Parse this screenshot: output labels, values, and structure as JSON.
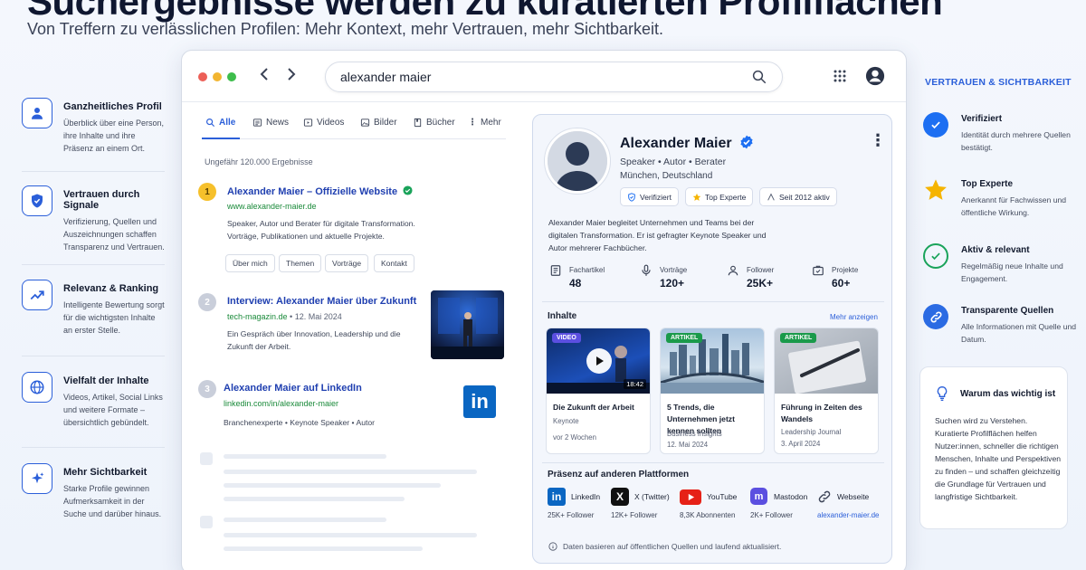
{
  "headline": "Suchergebnisse werden zu kuratierten Profilflächen",
  "subheadline": "Von Treffern zu verlässlichen Profilen: Mehr Kontext, mehr Vertrauen, mehr Sichtbarkeit.",
  "features": [
    {
      "icon": "user-icon",
      "title": "Ganzheitliches Profil",
      "desc": "Überblick über eine Person, ihre Inhalte und ihre Präsenz an einem Ort."
    },
    {
      "icon": "shield-icon",
      "title": "Vertrauen durch Signale",
      "desc": "Verifizierung, Quellen und Auszeichnungen schaffen Transparenz und Vertrauen."
    },
    {
      "icon": "trend-icon",
      "title": "Relevanz & Ranking",
      "desc": "Intelligente Bewertung sorgt für die wichtigsten Inhalte an erster Stelle."
    },
    {
      "icon": "globe-icon",
      "title": "Vielfalt der Inhalte",
      "desc": "Videos, Artikel, Social Links und weitere Formate – übersichtlich gebündelt."
    },
    {
      "icon": "sparkle-icon",
      "title": "Mehr Sichtbarkeit",
      "desc": "Starke Profile gewinnen Aufmerksamkeit in der Suche und darüber hinaus."
    }
  ],
  "search": {
    "query": "alexander maier"
  },
  "tabs": [
    "Alle",
    "News",
    "Videos",
    "Bilder",
    "Bücher",
    "Mehr"
  ],
  "result_count": "Ungefähr 120.000 Ergebnisse",
  "results": [
    {
      "num": "1",
      "title": "Alexander Maier – Offizielle Website",
      "url": "www.alexander-maier.de",
      "desc": "Speaker, Autor und Berater für digitale Transformation. Vorträge, Publikationen und aktuelle Projekte.",
      "chips": [
        "Über mich",
        "Themen",
        "Vorträge",
        "Kontakt"
      ]
    },
    {
      "num": "2",
      "title": "Interview: Alexander Maier über Zukunft",
      "url": "tech-magazin.de",
      "date": "12. Mai 2024",
      "desc": "Ein Gespräch über Innovation, Leadership und die Zukunft der Arbeit."
    },
    {
      "num": "3",
      "title": "Alexander Maier auf LinkedIn",
      "url": "linkedin.com/in/alexander-maier",
      "desc": "Branchenexperte • Keynote Speaker • Autor",
      "logo": "in"
    }
  ],
  "profile": {
    "name": "Alexander Maier",
    "role": "Speaker • Autor • Berater",
    "location": "München, Deutschland",
    "badges": [
      "Verifiziert",
      "Top Experte",
      "Seit 2012 aktiv"
    ],
    "bio": "Alexander Maier begleitet Unternehmen und Teams bei der digitalen Transformation. Er ist gefragter Keynote Speaker und Autor mehrerer Fachbücher.",
    "stats": [
      {
        "label": "Fachartikel",
        "value": "48"
      },
      {
        "label": "Vorträge",
        "value": "120+"
      },
      {
        "label": "Follower",
        "value": "25K+"
      },
      {
        "label": "Projekte",
        "value": "60+"
      }
    ],
    "content_title": "Inhalte",
    "more_label": "Mehr anzeigen",
    "cards": [
      {
        "tag": "VIDEO",
        "duration": "18:42",
        "title": "Die Zukunft der Arbeit",
        "source": "Keynote",
        "date": "vor 2 Wochen"
      },
      {
        "tag": "ARTIKEL",
        "title": "5 Trends, die Unternehmen jetzt kennen sollten",
        "source": "Business Insights",
        "date": "12. Mai 2024"
      },
      {
        "tag": "ARTIKEL",
        "title": "Führung in Zeiten des Wandels",
        "source": "Leadership Journal",
        "date": "3. April 2024"
      }
    ],
    "platforms_title": "Präsenz auf anderen Plattformen",
    "platforms": [
      {
        "name": "LinkedIn",
        "sub": "25K+ Follower",
        "color": "#0a66c2"
      },
      {
        "name": "X (Twitter)",
        "sub": "12K+ Follower",
        "color": "#111111"
      },
      {
        "name": "YouTube",
        "sub": "8,3K Abonnenten",
        "color": "#e62117"
      },
      {
        "name": "Mastodon",
        "sub": "2K+ Follower",
        "color": "#5b4fe0"
      },
      {
        "name": "Webseite",
        "sub": "alexander-maier.de",
        "color": "#2b5fd9"
      }
    ],
    "footnote": "Daten basieren auf öffentlichen Quellen und laufend aktualisiert."
  },
  "right": {
    "heading": "VERTRAUEN & SICHTBARKEIT",
    "items": [
      {
        "icon": "check-icon",
        "title": "Verifiziert",
        "desc": "Identität durch mehrere Quellen bestätigt."
      },
      {
        "icon": "star-icon",
        "title": "Top Experte",
        "desc": "Anerkannt für Fachwissen und öffentliche Wirkung."
      },
      {
        "icon": "check-circle-icon",
        "title": "Aktiv & relevant",
        "desc": "Regelmäßig neue Inhalte und Engagement."
      },
      {
        "icon": "link-icon",
        "title": "Transparente Quellen",
        "desc": "Alle Informationen mit Quelle und Datum."
      }
    ],
    "why_title": "Warum das wichtig ist",
    "why_text": "Suchen wird zu Verstehen. Kuratierte Profilflächen helfen Nutzer:innen, schneller die richtigen Menschen, Inhalte und Perspektiven zu finden – und schaffen gleichzeitig die Grundlage für Vertrauen und langfristige Sichtbarkeit."
  },
  "colors": {
    "accent": "#2b5fd9",
    "link": "#1f3fb0",
    "url": "#1a8a3a",
    "verified": "#1d6ff2",
    "star": "#f5b400",
    "active": "#1aa35a"
  }
}
